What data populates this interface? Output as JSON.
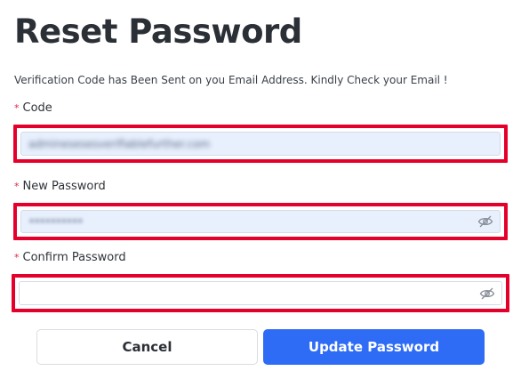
{
  "header": {
    "title": "Reset Password",
    "subtitle": "Verification Code has Been Sent on you Email Address. Kindly Check your Email !"
  },
  "form": {
    "required_marker": "*",
    "code": {
      "label": "Code",
      "value": "adminesesesverifiablefurther.com"
    },
    "new_password": {
      "label": "New Password",
      "value": "••••••••••"
    },
    "confirm_password": {
      "label": "Confirm Password",
      "value": ""
    },
    "cancel_label": "Cancel",
    "submit_label": "Update Password"
  },
  "colors": {
    "highlight": "#e5002b",
    "accent": "#2e6cf6",
    "autofill": "#e8f0fe"
  },
  "icons": {
    "password_toggle": "eye-slash-icon"
  }
}
